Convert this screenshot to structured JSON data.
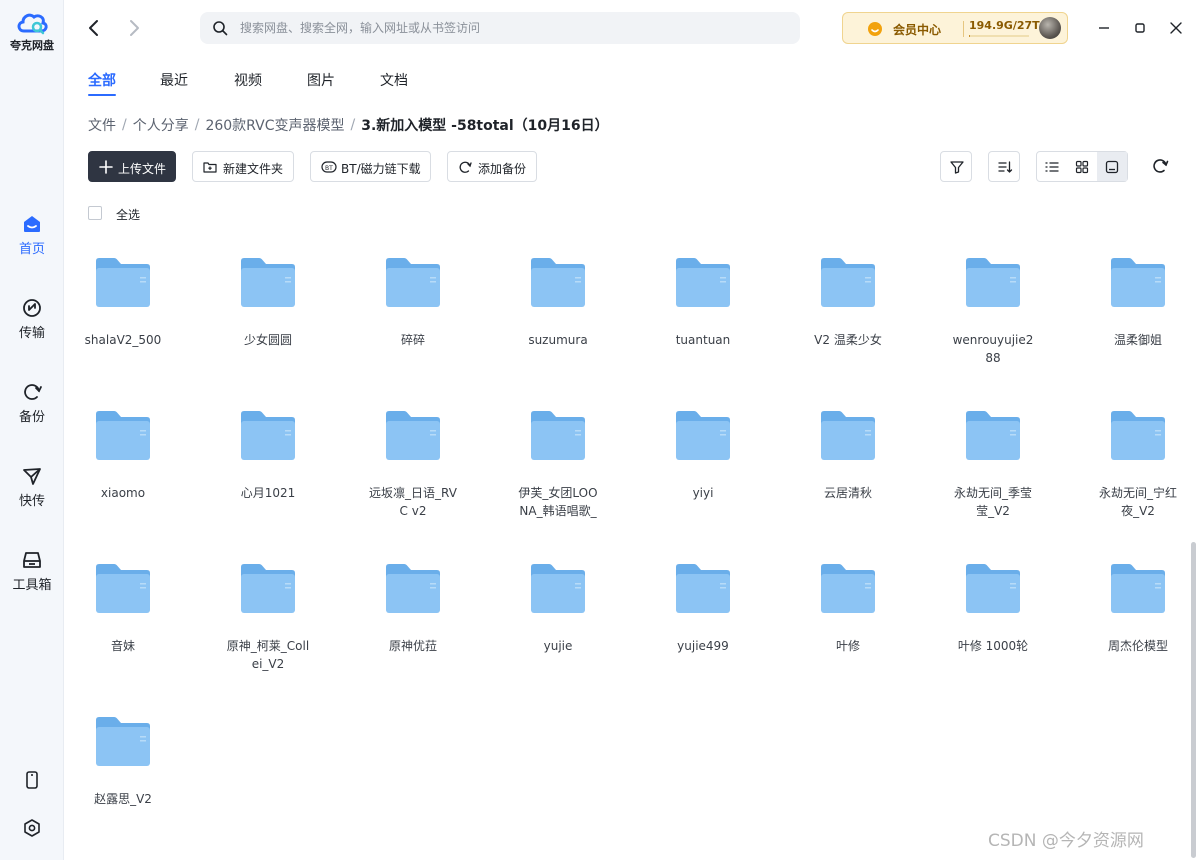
{
  "app": {
    "name": "夸克网盘"
  },
  "sidebar": {
    "items": [
      {
        "label": "首页",
        "icon": "home-icon"
      },
      {
        "label": "传输",
        "icon": "transfer-icon"
      },
      {
        "label": "备份",
        "icon": "backup-icon"
      },
      {
        "label": "快传",
        "icon": "quick-send-icon"
      },
      {
        "label": "工具箱",
        "icon": "toolbox-icon"
      }
    ],
    "bottom": [
      {
        "icon": "phone-icon"
      },
      {
        "icon": "settings-icon"
      }
    ]
  },
  "search": {
    "placeholder": "搜索网盘、搜索全网，输入网址或从书签访问"
  },
  "vip": {
    "label": "会员中心",
    "storage": "194.9G/27T",
    "usage_fraction": 0.007
  },
  "tabs": [
    {
      "label": "全部",
      "active": true
    },
    {
      "label": "最近"
    },
    {
      "label": "视频"
    },
    {
      "label": "图片"
    },
    {
      "label": "文档"
    }
  ],
  "breadcrumb": [
    "文件",
    "个人分享",
    "260款RVC变声器模型",
    "3.新加入模型 -58total（10月16日）"
  ],
  "toolbar": {
    "upload": "上传文件",
    "new_folder": "新建文件夹",
    "bt": "BT/磁力链下载",
    "backup": "添加备份"
  },
  "select_all": "全选",
  "folders": [
    "shalaV2_500",
    "少女圆圆",
    "碎碎",
    "suzumura",
    "tuantuan",
    "V2 温柔少女",
    "wenrouyujie288",
    "温柔御姐",
    "xiaomo",
    "心月1021",
    "远坂凛_日语_RVC v2",
    "伊芙_女团LOONA_韩语唱歌_",
    "yiyi",
    "云居清秋",
    "永劫无间_季莹莹_V2",
    "永劫无间_宁红夜_V2",
    "音妹",
    "原神_柯莱_Collei_V2",
    "原神优菈",
    "yujie",
    "yujie499",
    "叶修",
    "叶修 1000轮",
    "周杰伦模型",
    "赵露思_V2"
  ],
  "watermark": "CSDN @今夕资源网",
  "colors": {
    "accent": "#2b6bff",
    "folder": "#7ab8f0",
    "primary_button": "#2f3542"
  }
}
